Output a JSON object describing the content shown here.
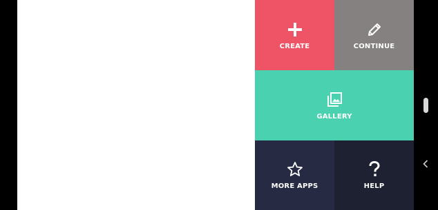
{
  "colors": {
    "create": "#ef5466",
    "continue": "#858180",
    "gallery": "#49d1b0",
    "more_apps": "#262b43",
    "help": "#1e2132",
    "canvas": "#ffffff",
    "system_bar": "#000000"
  },
  "menu": {
    "create": {
      "label": "CREATE",
      "icon": "plus-icon"
    },
    "continue": {
      "label": "CONTINUE",
      "icon": "pencil-icon"
    },
    "gallery": {
      "label": "GALLERY",
      "icon": "gallery-icon"
    },
    "more_apps": {
      "label": "MORE APPS",
      "icon": "star-icon"
    },
    "help": {
      "label": "HELP",
      "icon": "question-icon"
    }
  },
  "system": {
    "back_icon": "chevron-left-icon",
    "scroll_handle_icon": "scroll-handle"
  }
}
